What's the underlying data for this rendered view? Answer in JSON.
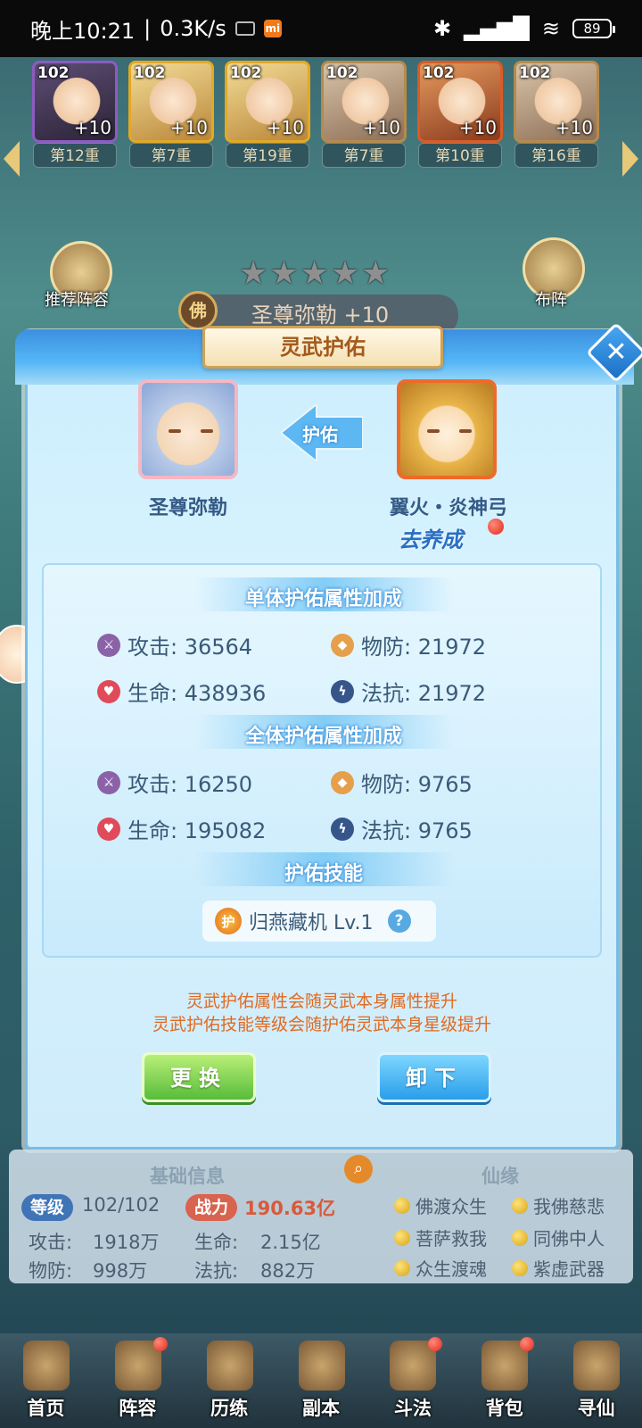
{
  "status_bar": {
    "time": "晚上10:21",
    "speed": "0.3K/s",
    "battery": "89"
  },
  "hero_row": {
    "heroes": [
      {
        "level": "102",
        "bonus": "+10",
        "tier": "第12重",
        "style": "purple"
      },
      {
        "level": "102",
        "bonus": "+10",
        "tier": "第7重",
        "style": "gold"
      },
      {
        "level": "102",
        "bonus": "+10",
        "tier": "第19重",
        "style": "gold"
      },
      {
        "level": "102",
        "bonus": "+10",
        "tier": "第7重",
        "style": "plain"
      },
      {
        "level": "102",
        "bonus": "+10",
        "tier": "第10重",
        "style": "red"
      },
      {
        "level": "102",
        "bonus": "+10",
        "tier": "第16重",
        "style": "plain"
      }
    ]
  },
  "side": {
    "recommend": "推荐阵容",
    "formation": "布阵"
  },
  "hero_header": {
    "stars": "★★★★★",
    "name": "圣尊弥勒 +10",
    "emblem": "佛"
  },
  "modal": {
    "title": "灵武护佑",
    "close": "✕",
    "protect_label": "护佑",
    "hero_name": "圣尊弥勒",
    "weapon_name": "翼火・炎神弓",
    "go_train": "去养成",
    "single_title": "单体护佑属性加成",
    "single_stats": [
      {
        "label": "攻击: 36564",
        "icon": "attack-icon"
      },
      {
        "label": "物防: 21972",
        "icon": "defense-icon"
      },
      {
        "label": "生命: 438936",
        "icon": "health-icon"
      },
      {
        "label": "法抗: 21972",
        "icon": "magic-resist-icon"
      }
    ],
    "all_title": "全体护佑属性加成",
    "all_stats": [
      {
        "label": "攻击: 16250",
        "icon": "attack-icon"
      },
      {
        "label": "物防: 9765",
        "icon": "defense-icon"
      },
      {
        "label": "生命: 195082",
        "icon": "health-icon"
      },
      {
        "label": "法抗: 9765",
        "icon": "magic-resist-icon"
      }
    ],
    "skill_title": "护佑技能",
    "skill_icon_text": "护",
    "skill_name": "归燕藏机 Lv.1",
    "note_1": "灵武护佑属性会随灵武本身属性提升",
    "note_2": "灵武护佑技能等级会随护佑灵武本身星级提升",
    "replace_btn": "更换",
    "unload_btn": "卸下"
  },
  "info": {
    "basic_title": "基础信息",
    "level_chip": "等级",
    "level_value": "102/102",
    "power_chip": "战力",
    "power_value": "190.63亿",
    "attack": "攻击:",
    "attack_value": "1918万",
    "hp": "生命:",
    "hp_value": "2.15亿",
    "defense": "物防:",
    "defense_value": "998万",
    "mres": "法抗:",
    "mres_value": "882万",
    "fate_title": "仙缘",
    "fates": [
      "佛渡众生",
      "我佛慈悲",
      "菩萨救我",
      "同佛中人",
      "众生渡魂",
      "紫虚武器"
    ]
  },
  "nav": {
    "items": [
      "首页",
      "阵容",
      "历练",
      "副本",
      "斗法",
      "背包",
      "寻仙"
    ]
  }
}
